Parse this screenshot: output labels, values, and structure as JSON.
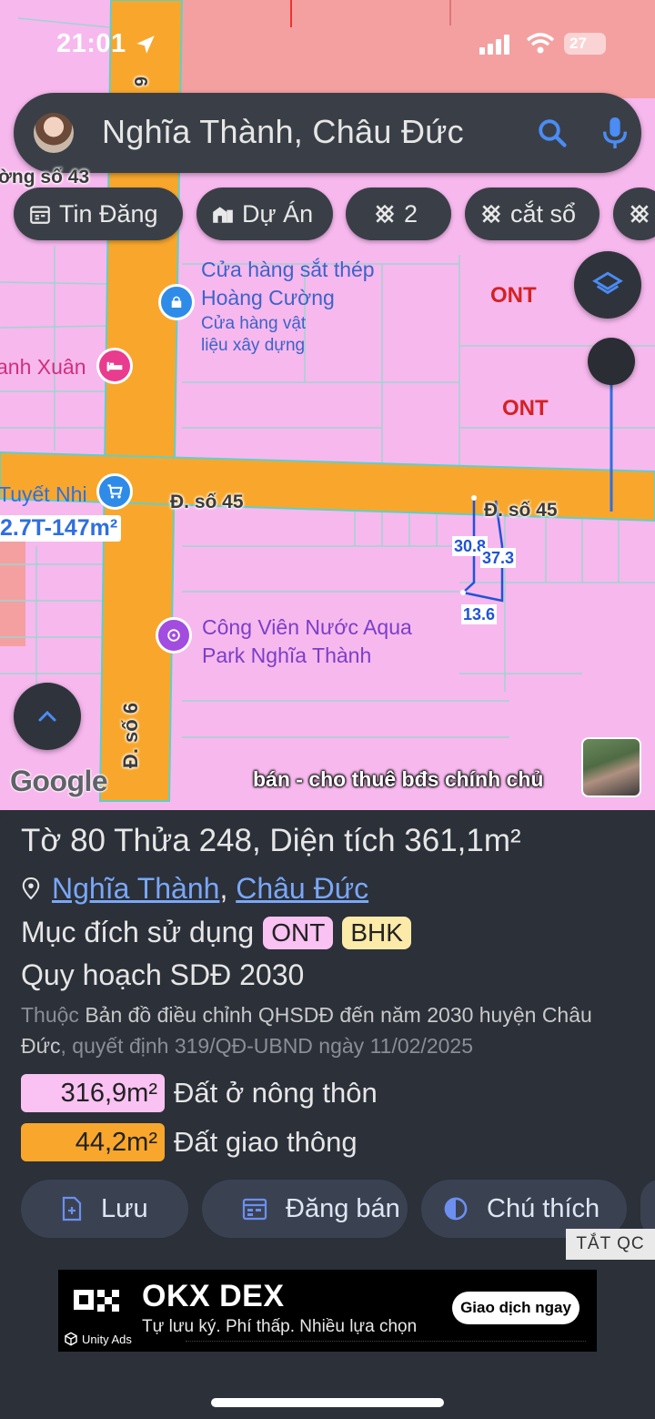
{
  "status_bar": {
    "time": "21:01",
    "battery": "27"
  },
  "search": {
    "query": "Nghĩa Thành, Châu Đức"
  },
  "chips": [
    {
      "label": "Tin Đăng",
      "icon": "calendar-icon"
    },
    {
      "label": "Dự Án",
      "icon": "buildings-icon"
    },
    {
      "label": "2",
      "icon": "parcel-icon"
    },
    {
      "label": "cắt sổ",
      "icon": "parcel-icon"
    },
    {
      "label": "",
      "icon": "parcel-icon"
    }
  ],
  "map": {
    "street_top": "ờng số 43",
    "road_d6_top": "6",
    "poi_steel_title_1": "Cửa hàng sắt thép",
    "poi_steel_title_2": "Hoàng Cường",
    "poi_steel_sub_1": "Cửa hàng vật",
    "poi_steel_sub_2": "liệu xây dựng",
    "poi_hotel": "anh Xuân",
    "poi_shop": "Tuyết Nhi",
    "price_label": "2.7T-147m²",
    "road_45_left": "Đ. số 45",
    "road_45_right": "Đ. số 45",
    "road_6": "Đ. số 6",
    "zone_1": "ONT",
    "zone_2": "ONT",
    "dim_1": "30.8",
    "dim_2": "37.3",
    "dim_3": "13.6",
    "poi_park_1": "Công Viên Nước Aqua",
    "poi_park_2": "Park Nghĩa Thành",
    "google": "Google",
    "overlay_text": "bán - cho thuê bđs chính chủ"
  },
  "parcel": {
    "title_pre1": "Tờ ",
    "sheet": "80",
    "title_pre2": " Thửa ",
    "lot": "248",
    "title_pre3": ", Diện tích ",
    "area": "361,1m²",
    "commune": "Nghĩa Thành",
    "sep": ", ",
    "district": "Châu Đức",
    "purpose_label": "Mục đích sử dụng",
    "purpose_badges": [
      {
        "label": "ONT",
        "color": "#f9c2f2"
      },
      {
        "label": "BHK",
        "color": "#fbeaa8"
      }
    ],
    "plan_title": "Quy hoạch SDĐ 2030",
    "belongs_prefix": "Thuộc ",
    "belongs_map": "Bản đồ điều chỉnh QHSDĐ đến năm 2030 huyện Châu Đức",
    "belongs_decision": ", quyết định 319/QĐ-UBND ngày 11/02/2025",
    "areas": [
      {
        "value": "316,9m²",
        "label": "Đất ở nông thôn",
        "color": "#f9c2f2"
      },
      {
        "value": "44,2m²",
        "label": "Đất giao thông",
        "color": "#f8a72c"
      }
    ]
  },
  "actions": {
    "save": "Lưu",
    "post": "Đăng bán",
    "legend": "Chú thích"
  },
  "ads": {
    "hide": "TẮT QC",
    "brand": "OKX DEX",
    "tagline": "Tự lưu ký. Phí thấp. Nhiều lựa chọn",
    "cta": "Giao dịch ngay",
    "network": "Unity Ads"
  }
}
